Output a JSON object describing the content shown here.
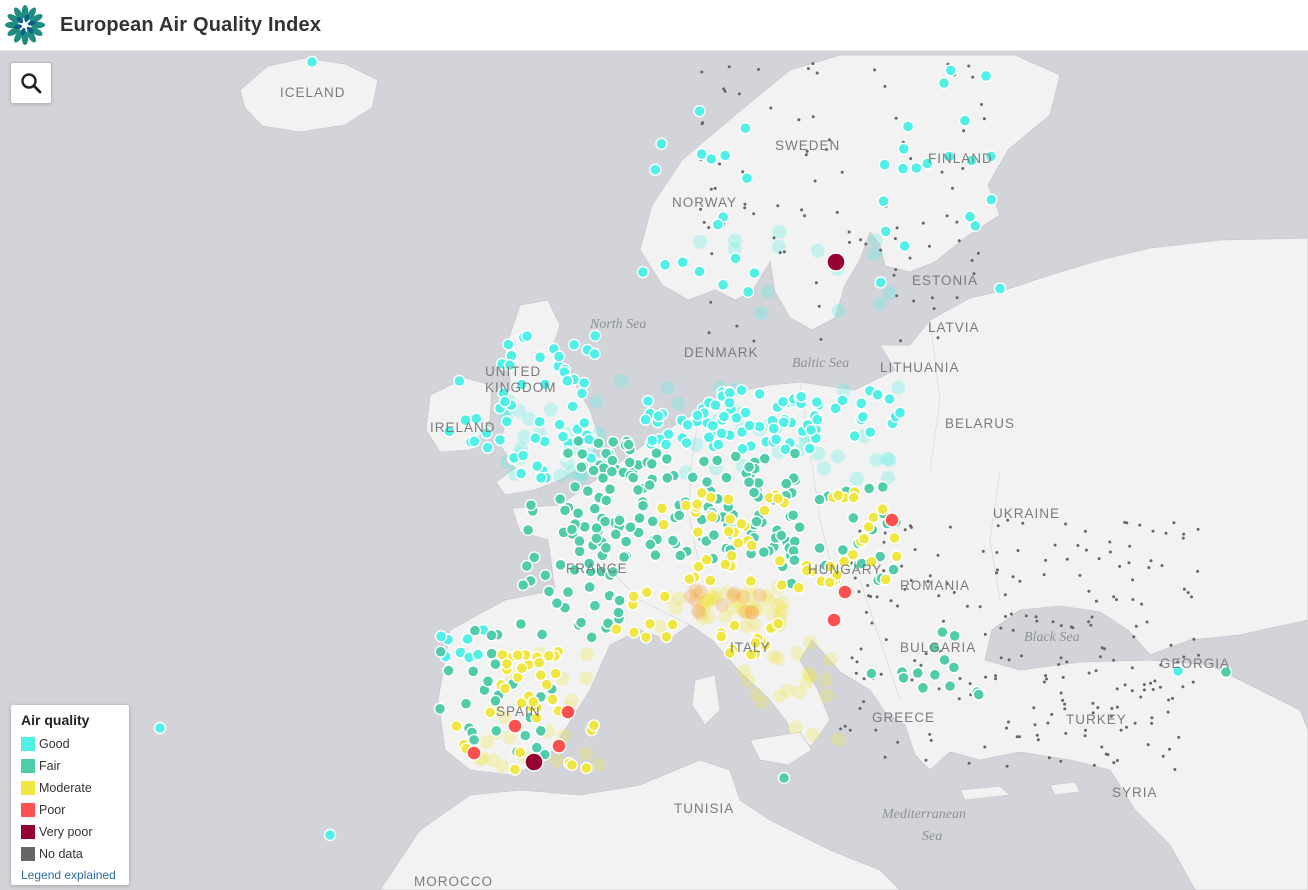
{
  "header": {
    "title": "European Air Quality Index"
  },
  "search": {
    "icon": "search-icon"
  },
  "colors": {
    "sea": "#d3d4d9",
    "land": "#f2f2f2",
    "good": "#50f0e6",
    "fair": "#50ccaa",
    "moderate": "#f0e641",
    "poor": "#ff5050",
    "very_poor": "#960032",
    "no_data": "#666666"
  },
  "legend": {
    "title": "Air quality",
    "items": [
      {
        "label": "Good",
        "color": "#50f0e6"
      },
      {
        "label": "Fair",
        "color": "#50ccaa"
      },
      {
        "label": "Moderate",
        "color": "#f0e641"
      },
      {
        "label": "Poor",
        "color": "#ff5050"
      },
      {
        "label": "Very poor",
        "color": "#960032"
      },
      {
        "label": "No data",
        "color": "#666666"
      }
    ],
    "link": "Legend explained"
  },
  "labels": {
    "iceland": "ICELAND",
    "sweden": "SWEDEN",
    "finland": "FINLAND",
    "norway": "NORWAY",
    "estonia": "ESTONIA",
    "latvia": "LATVIA",
    "lithuania": "LITHUANIA",
    "denmark": "DENMARK",
    "united": "UNITED",
    "kingdom": "KINGDOM",
    "ireland": "IRELAND",
    "belarus": "BELARUS",
    "ukraine": "UKRAINE",
    "hungary": "HUNGARY",
    "romania": "ROMANIA",
    "bulgaria": "BULGARIA",
    "greece": "GREECE",
    "turkey": "TURKEY",
    "georgia": "GEORGIA",
    "syria": "SYRIA",
    "tunisia": "TUNISIA",
    "morocco": "MOROCCO",
    "spain": "SPAIN",
    "france": "FRANCE",
    "italy": "ITALY",
    "north_sea": "North Sea",
    "baltic_sea": "Baltic Sea",
    "black_sea": "Black Sea",
    "mediterranean": "Mediterranean",
    "sea": "Sea"
  }
}
